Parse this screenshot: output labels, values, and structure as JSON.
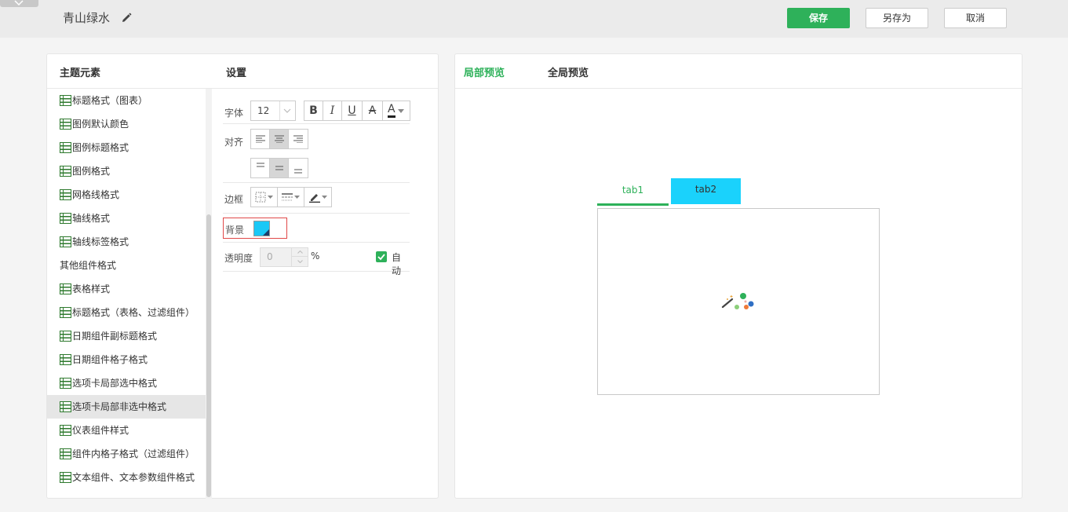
{
  "header": {
    "theme_name": "青山绿水",
    "save_label": "保存",
    "save_as_label": "另存为",
    "cancel_label": "取消"
  },
  "left_panel": {
    "elements_header": "主题元素",
    "settings_header": "设置",
    "items": [
      {
        "label": "标题格式（图表）",
        "icon": "table-icon"
      },
      {
        "label": "图例默认颜色",
        "icon": "table-icon"
      },
      {
        "label": "图例标题格式",
        "icon": "table-icon"
      },
      {
        "label": "图例格式",
        "icon": "table-icon"
      },
      {
        "label": "网格线格式",
        "icon": "table-icon"
      },
      {
        "label": "轴线格式",
        "icon": "table-icon"
      },
      {
        "label": "轴线标签格式",
        "icon": "table-icon"
      },
      {
        "label": "其他组件格式",
        "icon": ""
      },
      {
        "label": "表格样式",
        "icon": "table-icon"
      },
      {
        "label": "标题格式（表格、过滤组件）",
        "icon": "table-icon"
      },
      {
        "label": "日期组件副标题格式",
        "icon": "table-icon"
      },
      {
        "label": "日期组件格子格式",
        "icon": "table-icon"
      },
      {
        "label": "选项卡局部选中格式",
        "icon": "table-icon"
      },
      {
        "label": "选项卡局部非选中格式",
        "icon": "table-icon",
        "selected": true
      },
      {
        "label": "仪表组件样式",
        "icon": "table-icon"
      },
      {
        "label": "组件内格子格式（过滤组件）",
        "icon": "table-icon"
      },
      {
        "label": "文本组件、文本参数组件格式",
        "icon": "table-icon"
      }
    ]
  },
  "settings": {
    "font_label": "字体",
    "font_size": "12",
    "bold": "B",
    "italic": "I",
    "underline": "U",
    "strikethrough": "A",
    "font_color": "A",
    "align_label": "对齐",
    "horizontal_align_selected": "center",
    "vertical_align_selected": "middle",
    "border_label": "边框",
    "background_label": "背景",
    "background_color": "#1ac8f6",
    "opacity_label": "透明度",
    "opacity_value": "0",
    "opacity_unit": "%",
    "auto_label": "自动",
    "auto_checked": true
  },
  "right_panel": {
    "local_preview_tab": "局部预览",
    "global_preview_tab": "全局预览",
    "preview_tabs": [
      "tab1",
      "tab2"
    ],
    "accent_color": "#2eb15a",
    "tab2_background": "#1ad2fc"
  }
}
